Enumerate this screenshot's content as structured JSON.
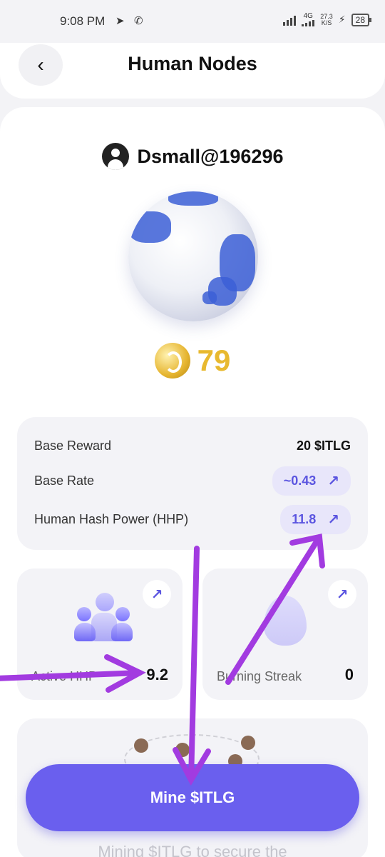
{
  "status_bar": {
    "time": "9:08 PM",
    "network_label": "4G",
    "speed_value": "27.3",
    "speed_unit": "K/S",
    "battery": "28"
  },
  "header": {
    "title": "Human Nodes"
  },
  "user": {
    "name": "Dsmall@196296"
  },
  "score": {
    "value": "79"
  },
  "stats": {
    "base_reward_label": "Base Reward",
    "base_reward_value": "20 $ITLG",
    "base_rate_label": "Base Rate",
    "base_rate_value": "~0.43",
    "hhp_label": "Human Hash Power (HHP)",
    "hhp_value": "11.8"
  },
  "cards": {
    "active_hhp_label": "Active HHP",
    "active_hhp_value": "9.2",
    "burning_streak_label": "Burning Streak",
    "burning_streak_value": "0"
  },
  "mine": {
    "button_label": "Mine $ITLG",
    "caption": "Mining $ITLG to secure the"
  },
  "colors": {
    "accent": "#6a5fee",
    "annotation": "#a23be0",
    "coin": "#e8b92f"
  }
}
